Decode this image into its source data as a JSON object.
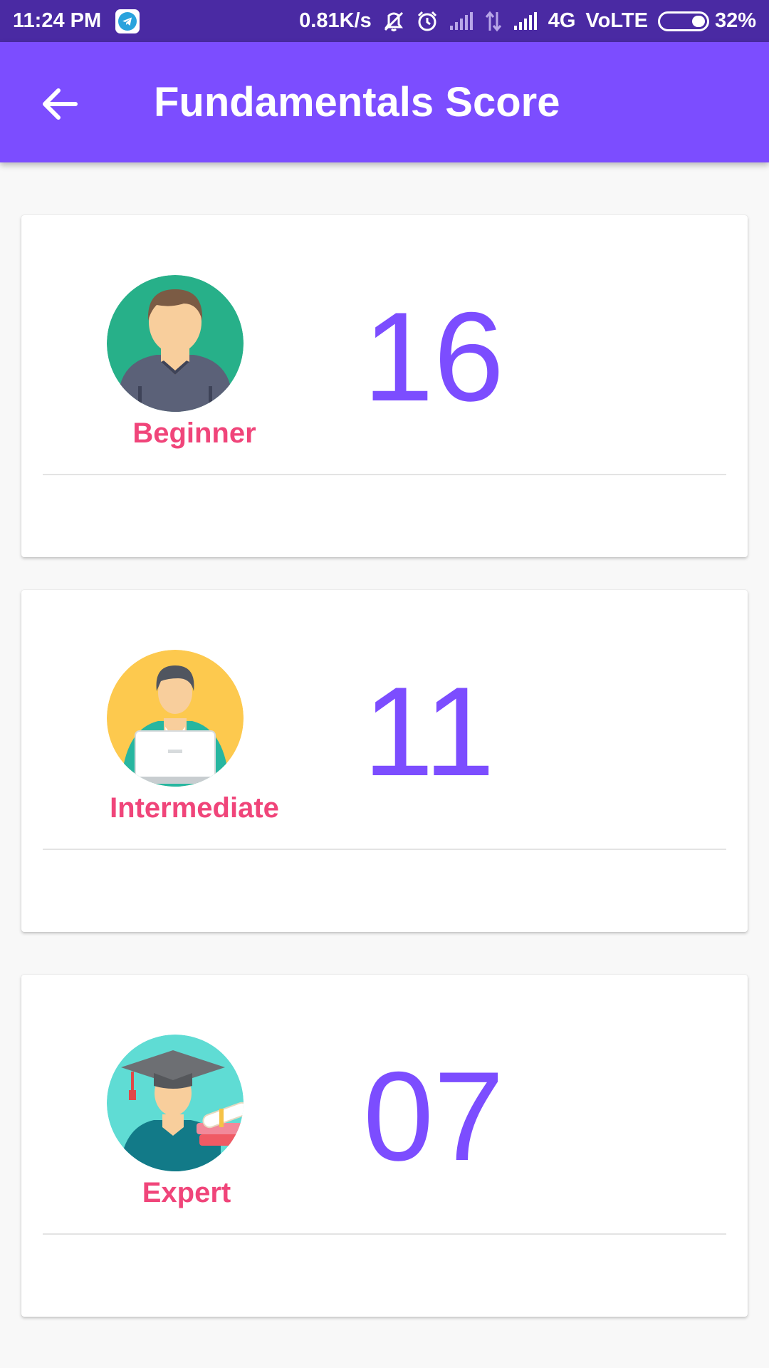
{
  "status_bar": {
    "time": "11:24 PM",
    "network_speed": "0.81K/s",
    "network_type": "4G",
    "volte": "VoLTE",
    "battery": "32%",
    "icons": [
      "telegram-icon",
      "mute-vibrate-icon",
      "alarm-icon",
      "signal-icon",
      "data-arrows-icon",
      "signal-full-icon",
      "battery-icon"
    ]
  },
  "app_bar": {
    "title": "Fundamentals Score",
    "back_icon": "arrow-back-icon",
    "color": "#7c4dff"
  },
  "colors": {
    "status_bar": "#4a2aa3",
    "accent": "#7c4dff",
    "level_label": "#f0457a"
  },
  "scores": [
    {
      "level": "Beginner",
      "score": "16",
      "avatar": "beginner-avatar"
    },
    {
      "level": "Intermediate",
      "score": "11",
      "avatar": "intermediate-avatar"
    },
    {
      "level": "Expert",
      "score": "07",
      "avatar": "expert-avatar"
    }
  ]
}
